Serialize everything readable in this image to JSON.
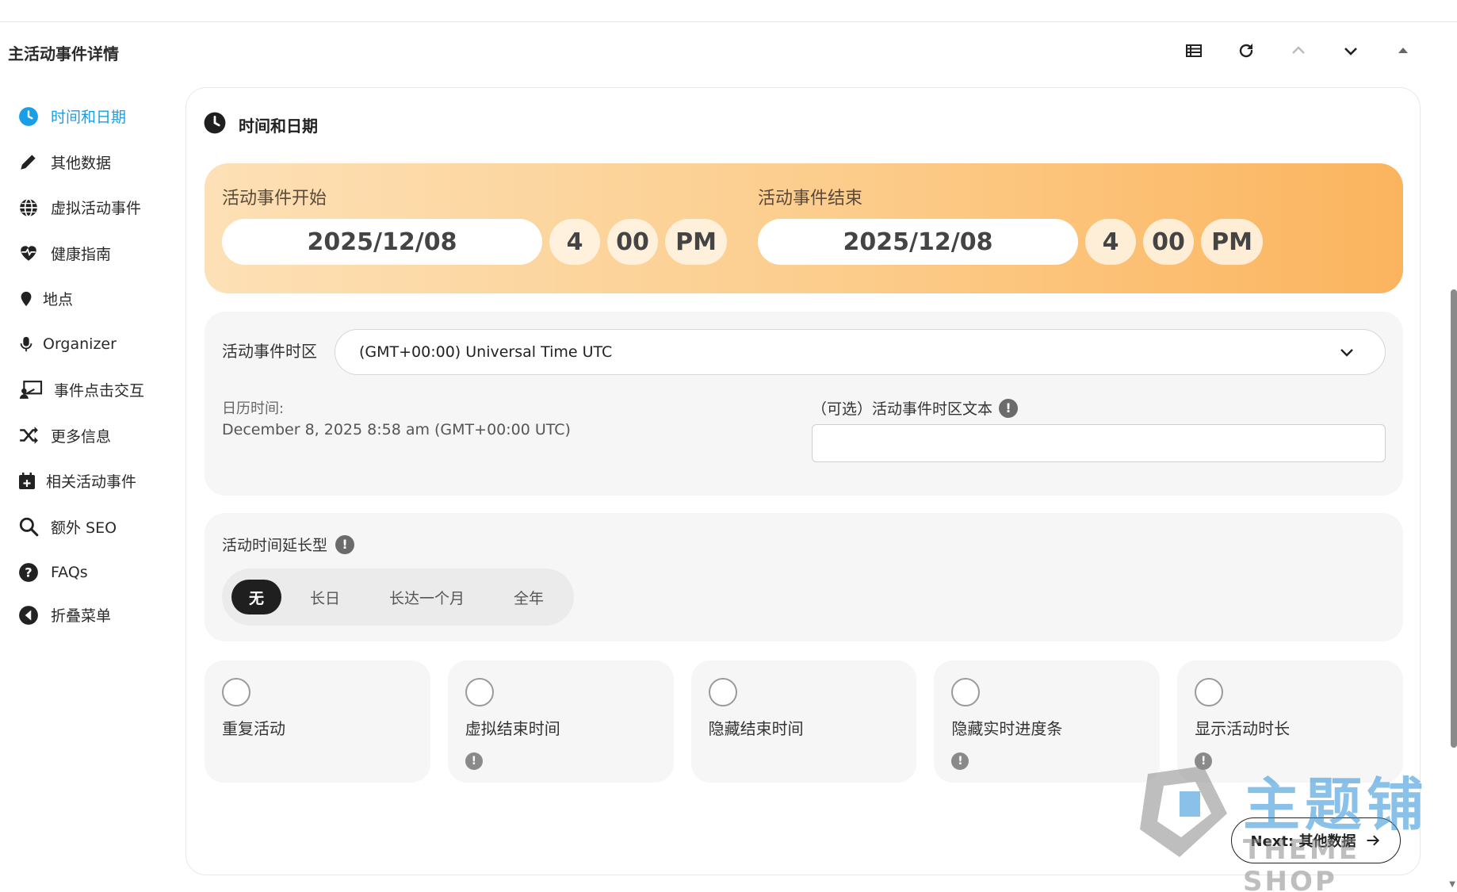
{
  "header": {
    "title": "主活动事件详情"
  },
  "toolbar": {
    "icons": [
      "table-icon",
      "refresh-icon",
      "chevron-up-icon",
      "chevron-down-icon",
      "caret-up-icon"
    ]
  },
  "sidebar": {
    "items": [
      {
        "label": "时间和日期",
        "icon": "clock-icon",
        "active": true
      },
      {
        "label": "其他数据",
        "icon": "pencil-icon"
      },
      {
        "label": "虚拟活动事件",
        "icon": "globe-icon"
      },
      {
        "label": "健康指南",
        "icon": "heartbeat-icon"
      },
      {
        "label": "地点",
        "icon": "map-pin-icon"
      },
      {
        "label": "Organizer",
        "icon": "microphone-icon"
      },
      {
        "label": "事件点击交互",
        "icon": "presentation-icon"
      },
      {
        "label": "更多信息",
        "icon": "shuffle-icon"
      },
      {
        "label": "相关活动事件",
        "icon": "calendar-plus-icon"
      },
      {
        "label": "额外 SEO",
        "icon": "search-icon"
      },
      {
        "label": "FAQs",
        "icon": "question-circle-icon"
      },
      {
        "label": "折叠菜单",
        "icon": "collapse-left-icon"
      }
    ]
  },
  "section": {
    "title": "时间和日期"
  },
  "start": {
    "label": "活动事件开始",
    "date": "2025/12/08",
    "hour": "4",
    "minute": "00",
    "ampm": "PM"
  },
  "end": {
    "label": "活动事件结束",
    "date": "2025/12/08",
    "hour": "4",
    "minute": "00",
    "ampm": "PM"
  },
  "timezone": {
    "label": "活动事件时区",
    "value": "(GMT+00:00) Universal Time UTC",
    "calendar_label": "日历时间:",
    "calendar_value": "December 8, 2025 8:58 am (GMT+00:00 UTC)",
    "optional_label": "（可选）活动事件时区文本",
    "optional_value": ""
  },
  "extension": {
    "label": "活动时间延长型",
    "options": [
      "无",
      "长日",
      "长达一个月",
      "全年"
    ],
    "selected": "无"
  },
  "toggles": [
    {
      "label": "重复活动",
      "info": false
    },
    {
      "label": "虚拟结束时间",
      "info": true
    },
    {
      "label": "隐藏结束时间",
      "info": false
    },
    {
      "label": "隐藏实时进度条",
      "info": true
    },
    {
      "label": "显示活动时长",
      "info": true
    }
  ],
  "next_button": {
    "label": "Next: 其他数据"
  },
  "watermark": {
    "text": "主题铺",
    "sub": "THEME SHOP"
  },
  "colors": {
    "accent": "#1a9ee6",
    "banner_start": "#fde0b6",
    "banner_end": "#fbb45e"
  }
}
